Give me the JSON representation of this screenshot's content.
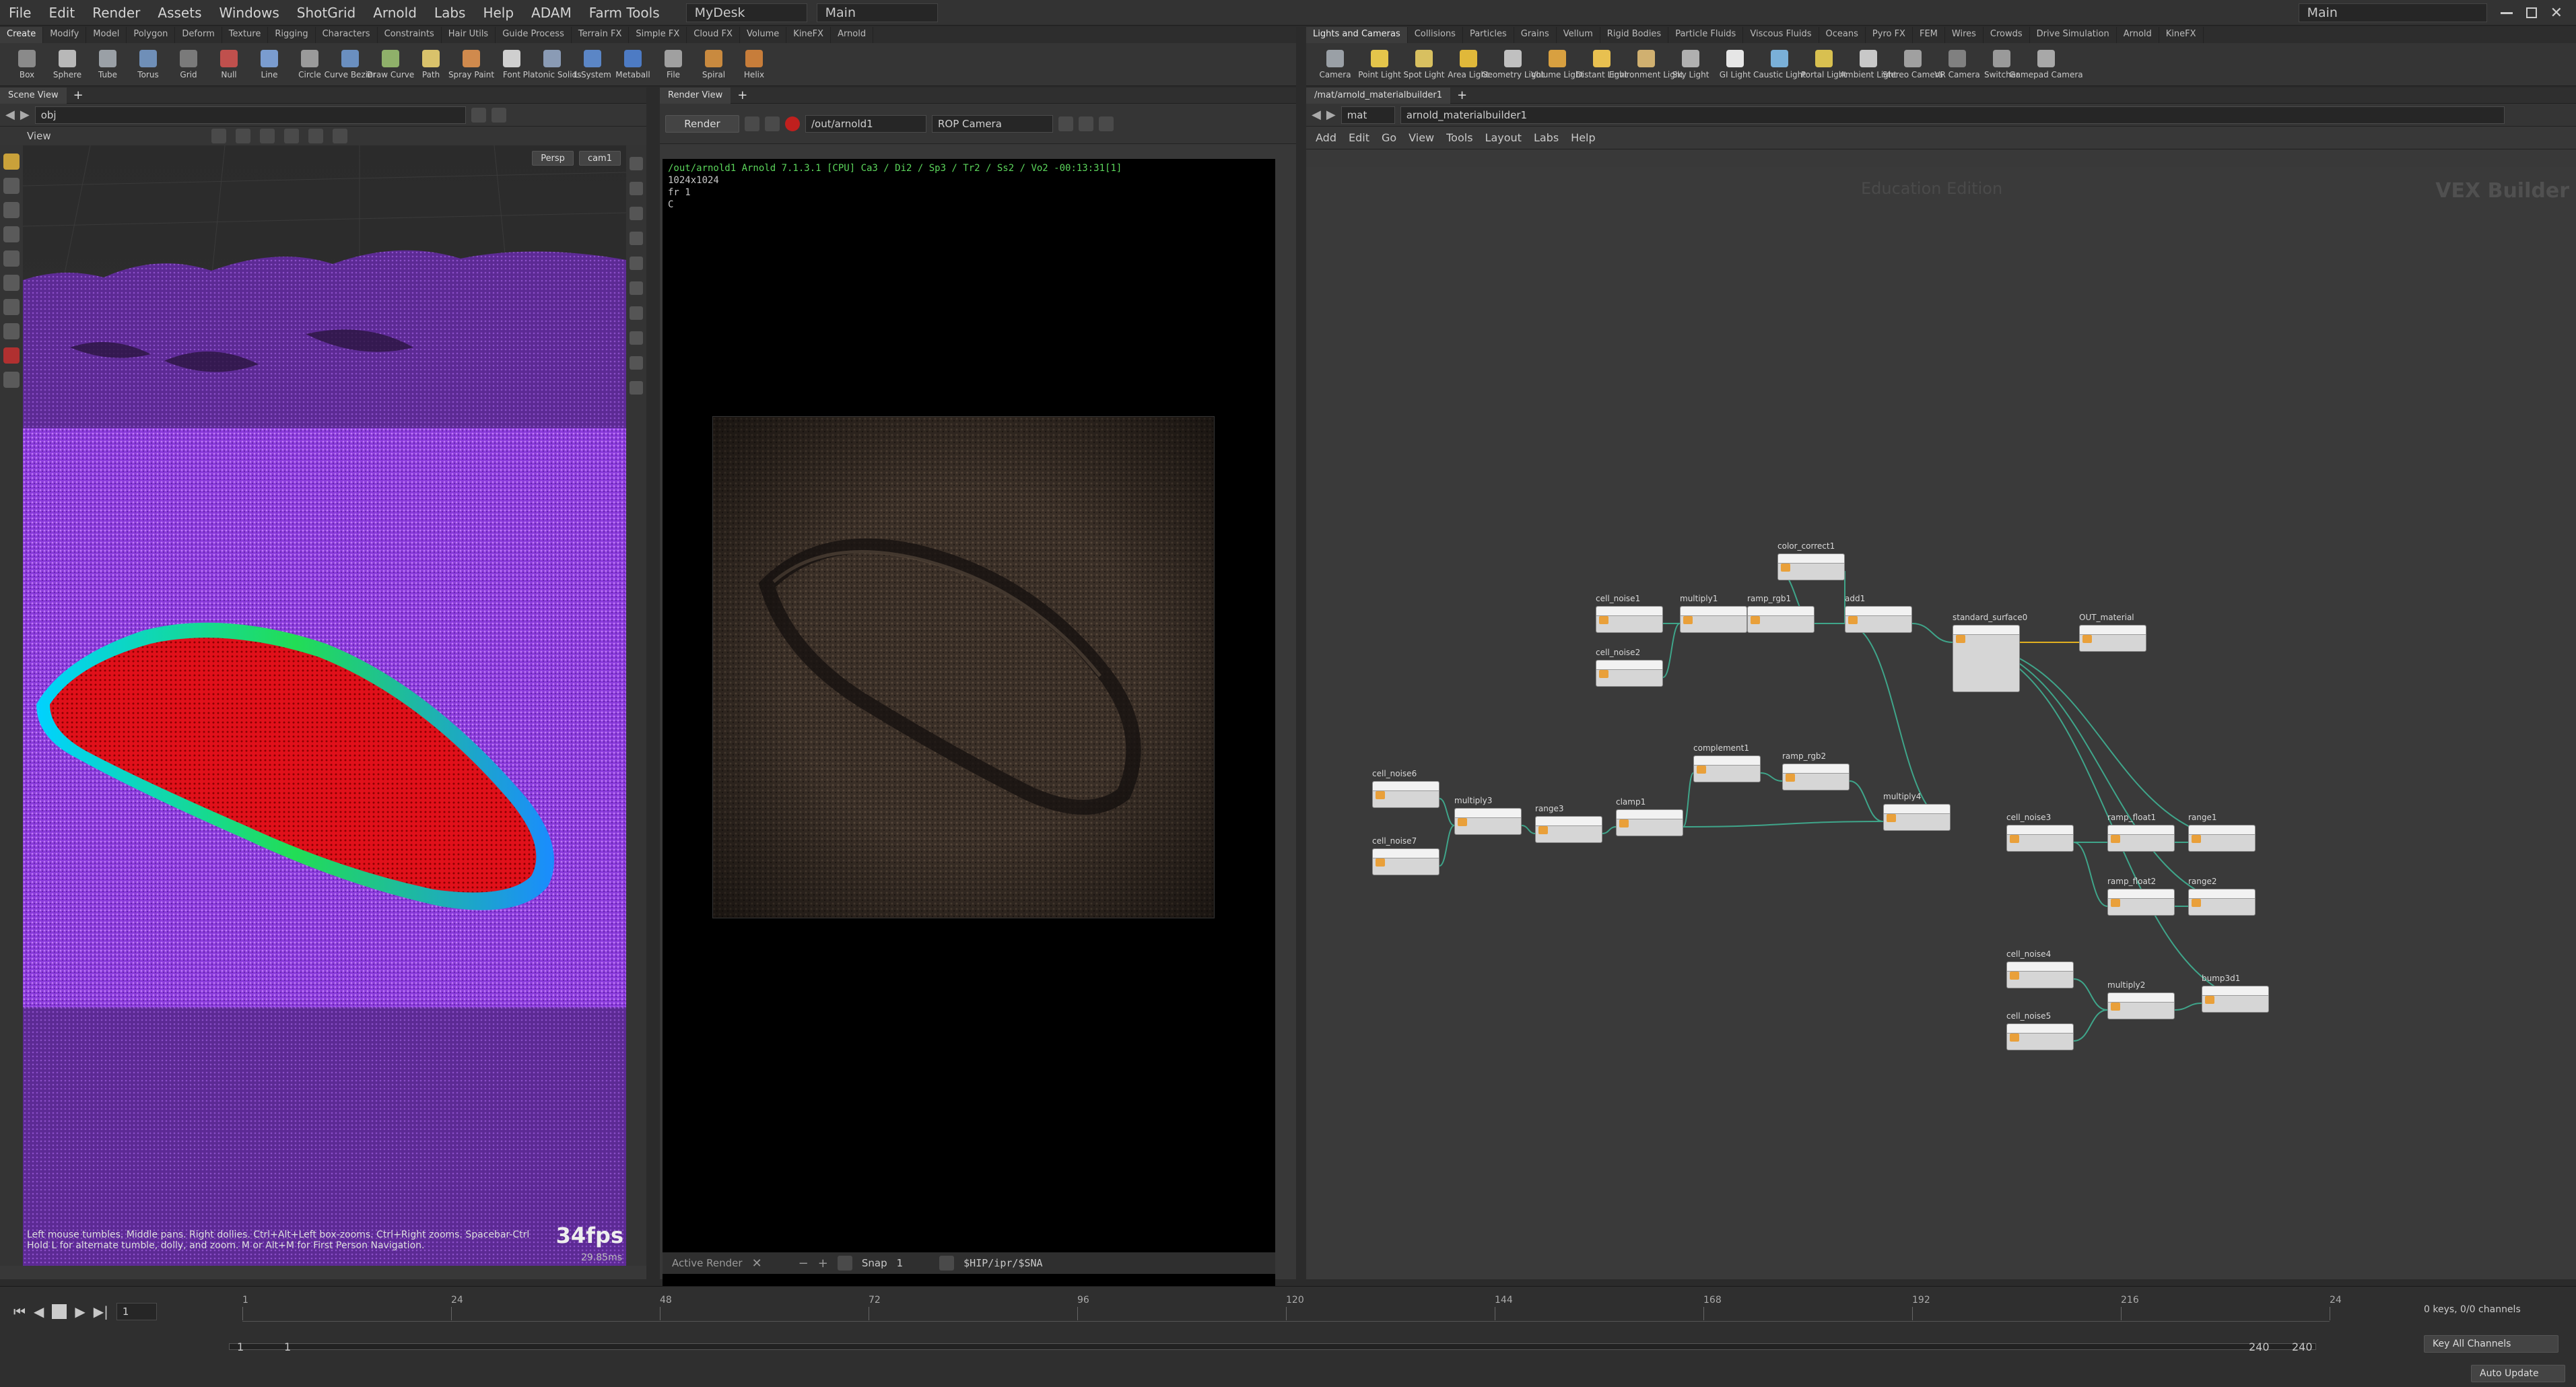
{
  "menu": [
    "File",
    "Edit",
    "Render",
    "Assets",
    "Windows",
    "ShotGrid",
    "Arnold",
    "Labs",
    "Help",
    "ADAM",
    "Farm Tools"
  ],
  "desk": {
    "label": "MyDesk",
    "main": "Main",
    "right_main": "Main"
  },
  "shelf_left": {
    "tabs": [
      "Create",
      "Modify",
      "Model",
      "Polygon",
      "Deform",
      "Texture",
      "Rigging",
      "Characters",
      "Constraints",
      "Hair Utils",
      "Guide Process",
      "Terrain FX",
      "Simple FX",
      "Cloud FX",
      "Volume",
      "KineFX",
      "Arnold"
    ],
    "tools": [
      "Box",
      "Sphere",
      "Tube",
      "Torus",
      "Grid",
      "Null",
      "Line",
      "Circle",
      "Curve Bezier",
      "Draw Curve",
      "Path",
      "Spray Paint",
      "Font",
      "Platonic Solids",
      "L-System",
      "Metaball",
      "File",
      "Spiral",
      "Helix"
    ]
  },
  "shelf_right": {
    "tabs": [
      "Lights and Cameras",
      "Collisions",
      "Particles",
      "Grains",
      "Vellum",
      "Rigid Bodies",
      "Particle Fluids",
      "Viscous Fluids",
      "Oceans",
      "Pyro FX",
      "FEM",
      "Wires",
      "Crowds",
      "Drive Simulation",
      "Arnold",
      "KineFX"
    ],
    "tools": [
      "Camera",
      "Point Light",
      "Spot Light",
      "Area Light",
      "Geometry Light",
      "Volume Light",
      "Distant Light",
      "Environment Light",
      "Sky Light",
      "GI Light",
      "Caustic Light",
      "Portal Light",
      "Ambient Light",
      "Stereo Camera",
      "VR Camera",
      "Switcher",
      "Gamepad Camera"
    ]
  },
  "scene": {
    "tab": "Scene View",
    "path": "obj",
    "view_label": "View",
    "persp": "Persp",
    "cam": "cam1",
    "help1": "Left mouse tumbles. Middle pans. Right dollies. Ctrl+Alt+Left box-zooms. Ctrl+Right zooms. Spacebar-Ctrl",
    "help2": "Hold L for alternate tumble, dolly, and zoom.   M or Alt+M for First Person Navigation.",
    "fps": "34fps",
    "ms": "29.85ms"
  },
  "render": {
    "tab": "Render View",
    "render_btn": "Render",
    "rop": "/out/arnold1",
    "camera": "ROP Camera",
    "info1": "/out/arnold1  Arnold 7.1.3.1 [CPU]  Ca3 / Di2 / Sp3 / Tr2 / Ss2 / Vo2 -00:13:31[1]",
    "info2": "1024x1024",
    "info3": "fr 1",
    "info4": "C",
    "active_render": "Active Render",
    "snap": "Snap",
    "snap_num": "1",
    "hip": "$HIP/ipr/$SNA"
  },
  "network": {
    "tab": "/mat/arnold_materialbuilder1",
    "path1": "mat",
    "path2": "arnold_materialbuilder1",
    "menu": [
      "Add",
      "Edit",
      "Go",
      "View",
      "Tools",
      "Layout",
      "Labs",
      "Help"
    ],
    "watermark": "Education Edition",
    "builder": "VEX Builder",
    "nodes": [
      {
        "id": "cell_noise1",
        "label": "cell_noise1"
      },
      {
        "id": "cell_noise2",
        "label": "cell_noise2"
      },
      {
        "id": "multiply1",
        "label": "multiply1"
      },
      {
        "id": "ramp_rgb1",
        "label": "ramp_rgb1"
      },
      {
        "id": "color_correct1",
        "label": "color_correct1"
      },
      {
        "id": "add1",
        "label": "add1"
      },
      {
        "id": "standard_surface0",
        "label": "standard_surface0"
      },
      {
        "id": "out_material",
        "label": "OUT_material"
      },
      {
        "id": "cell_noise6",
        "label": "cell_noise6"
      },
      {
        "id": "cell_noise7",
        "label": "cell_noise7"
      },
      {
        "id": "multiply3",
        "label": "multiply3"
      },
      {
        "id": "range3",
        "label": "range3"
      },
      {
        "id": "clamp1",
        "label": "clamp1"
      },
      {
        "id": "complement1",
        "label": "complement1"
      },
      {
        "id": "ramp_rgb2",
        "label": "ramp_rgb2"
      },
      {
        "id": "multiply4",
        "label": "multiply4"
      },
      {
        "id": "cell_noise3",
        "label": "cell_noise3"
      },
      {
        "id": "ramp_float1",
        "label": "ramp_float1"
      },
      {
        "id": "range1",
        "label": "range1"
      },
      {
        "id": "ramp_float2",
        "label": "ramp_float2"
      },
      {
        "id": "range2",
        "label": "range2"
      },
      {
        "id": "cell_noise4",
        "label": "cell_noise4"
      },
      {
        "id": "cell_noise5",
        "label": "cell_noise5"
      },
      {
        "id": "multiply2",
        "label": "multiply2"
      },
      {
        "id": "bump3d1",
        "label": "bump3d1"
      }
    ]
  },
  "timeline": {
    "ticks": [
      "1",
      "24",
      "48",
      "72",
      "96",
      "120",
      "144",
      "168",
      "192",
      "216",
      "24"
    ],
    "frame": "1",
    "start1": "1",
    "start2": "1",
    "end1": "240",
    "end2": "240",
    "keys": "0 keys, 0/0 channels",
    "key_all": "Key All Channels",
    "auto_update": "Auto Update"
  }
}
